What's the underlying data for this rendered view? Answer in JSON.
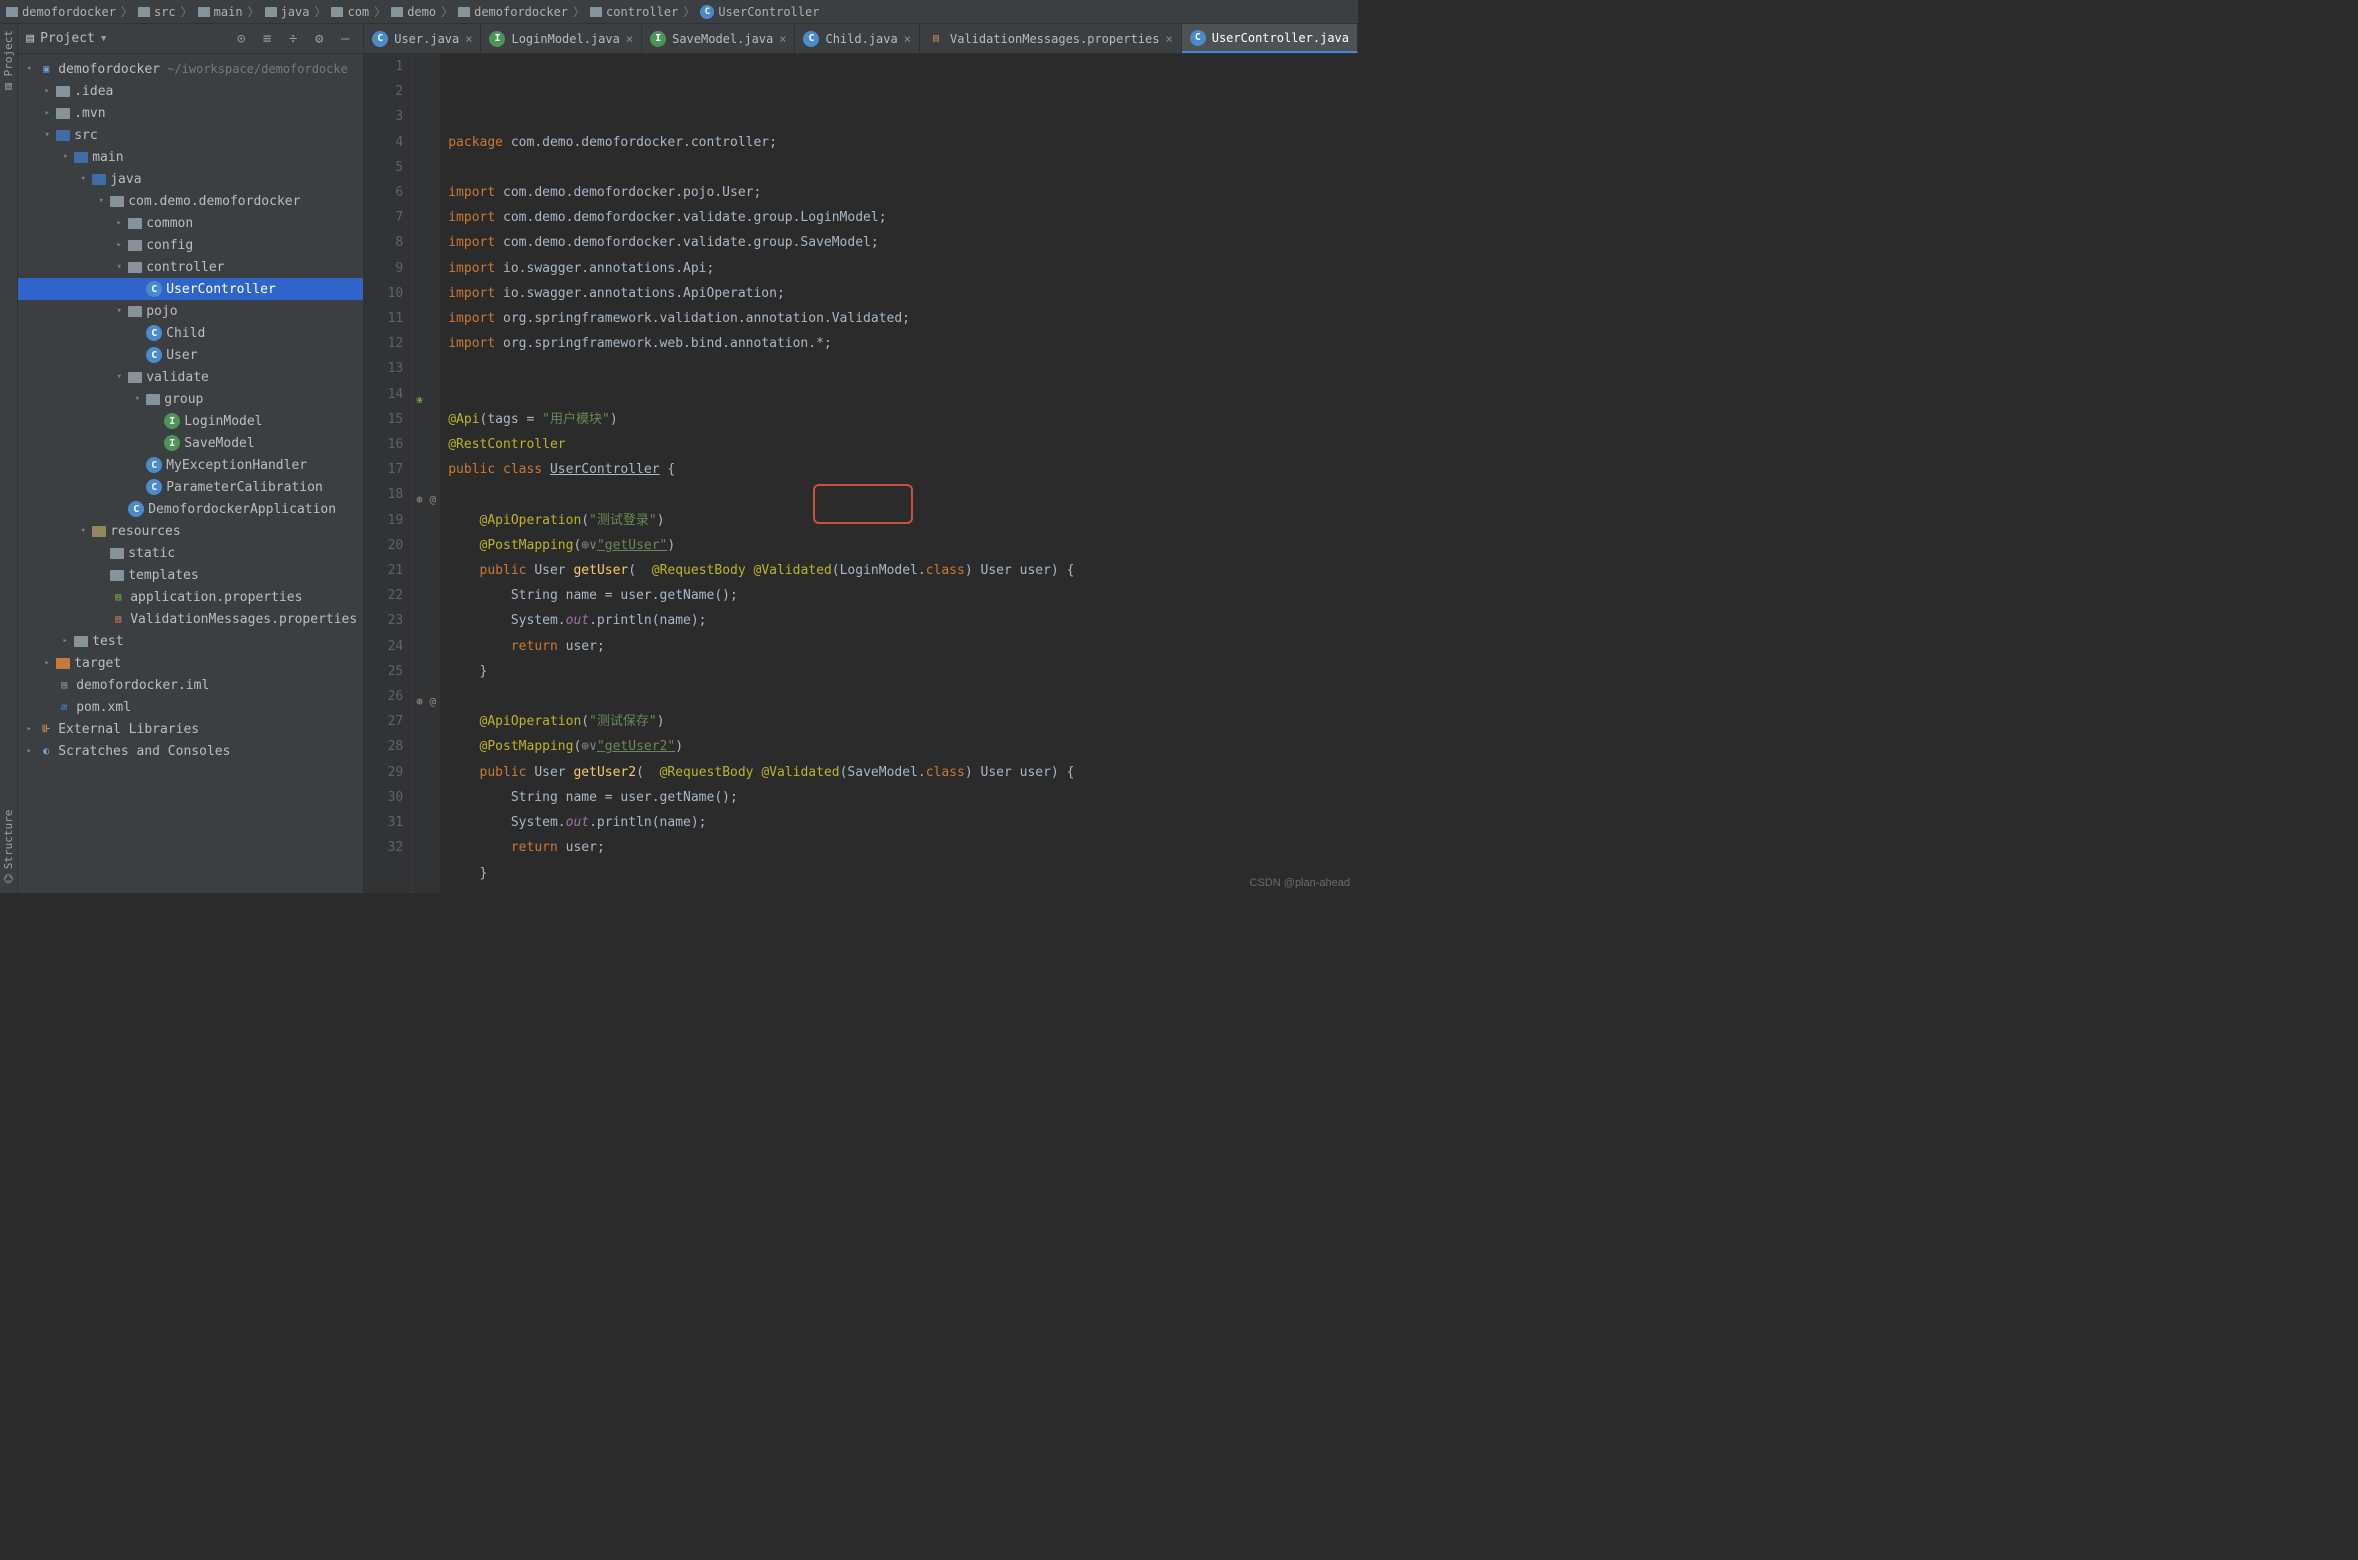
{
  "breadcrumb": [
    "demofordocker",
    "src",
    "main",
    "java",
    "com",
    "demo",
    "demofordocker",
    "controller",
    "UserController"
  ],
  "project": {
    "title": "Project",
    "tree": [
      {
        "depth": 0,
        "arrow": "down",
        "icon": "module",
        "label": "demofordocker",
        "dim": "  ~/iworkspace/demofordocke"
      },
      {
        "depth": 1,
        "arrow": "right",
        "icon": "folder",
        "label": ".idea"
      },
      {
        "depth": 1,
        "arrow": "right",
        "icon": "folder",
        "label": ".mvn"
      },
      {
        "depth": 1,
        "arrow": "down",
        "icon": "folder-src",
        "label": "src"
      },
      {
        "depth": 2,
        "arrow": "down",
        "icon": "folder-src",
        "label": "main"
      },
      {
        "depth": 3,
        "arrow": "down",
        "icon": "folder-src",
        "label": "java"
      },
      {
        "depth": 4,
        "arrow": "down",
        "icon": "pkg",
        "label": "com.demo.demofordocker"
      },
      {
        "depth": 5,
        "arrow": "right",
        "icon": "pkg",
        "label": "common"
      },
      {
        "depth": 5,
        "arrow": "right",
        "icon": "pkg",
        "label": "config"
      },
      {
        "depth": 5,
        "arrow": "down",
        "icon": "pkg",
        "label": "controller"
      },
      {
        "depth": 6,
        "arrow": "none",
        "icon": "class",
        "label": "UserController",
        "selected": true
      },
      {
        "depth": 5,
        "arrow": "down",
        "icon": "pkg",
        "label": "pojo"
      },
      {
        "depth": 6,
        "arrow": "none",
        "icon": "class",
        "label": "Child"
      },
      {
        "depth": 6,
        "arrow": "none",
        "icon": "class",
        "label": "User"
      },
      {
        "depth": 5,
        "arrow": "down",
        "icon": "pkg",
        "label": "validate"
      },
      {
        "depth": 6,
        "arrow": "down",
        "icon": "pkg",
        "label": "group"
      },
      {
        "depth": 7,
        "arrow": "none",
        "icon": "interface",
        "label": "LoginModel"
      },
      {
        "depth": 7,
        "arrow": "none",
        "icon": "interface",
        "label": "SaveModel"
      },
      {
        "depth": 6,
        "arrow": "none",
        "icon": "class",
        "label": "MyExceptionHandler"
      },
      {
        "depth": 6,
        "arrow": "none",
        "icon": "class",
        "label": "ParameterCalibration"
      },
      {
        "depth": 5,
        "arrow": "none",
        "icon": "class-spring",
        "label": "DemofordockerApplication"
      },
      {
        "depth": 3,
        "arrow": "down",
        "icon": "folder-res",
        "label": "resources"
      },
      {
        "depth": 4,
        "arrow": "none",
        "icon": "folder",
        "label": "static"
      },
      {
        "depth": 4,
        "arrow": "none",
        "icon": "folder",
        "label": "templates"
      },
      {
        "depth": 4,
        "arrow": "none",
        "icon": "file-spring",
        "label": "application.properties"
      },
      {
        "depth": 4,
        "arrow": "none",
        "icon": "file-prop",
        "label": "ValidationMessages.properties"
      },
      {
        "depth": 2,
        "arrow": "right",
        "icon": "folder",
        "label": "test"
      },
      {
        "depth": 1,
        "arrow": "right",
        "icon": "folder-target",
        "label": "target"
      },
      {
        "depth": 1,
        "arrow": "none",
        "icon": "file",
        "label": "demofordocker.iml"
      },
      {
        "depth": 1,
        "arrow": "none",
        "icon": "xml",
        "label": "pom.xml"
      },
      {
        "depth": 0,
        "arrow": "right",
        "icon": "lib",
        "label": "External Libraries"
      },
      {
        "depth": 0,
        "arrow": "right",
        "icon": "scratch",
        "label": "Scratches and Consoles"
      }
    ]
  },
  "tabs": [
    {
      "icon": "class",
      "label": "User.java"
    },
    {
      "icon": "interface",
      "label": "LoginModel.java"
    },
    {
      "icon": "interface",
      "label": "SaveModel.java"
    },
    {
      "icon": "class",
      "label": "Child.java"
    },
    {
      "icon": "prop",
      "label": "ValidationMessages.properties"
    },
    {
      "icon": "class",
      "label": "UserController.java",
      "active": true
    }
  ],
  "code": {
    "lines": [
      {
        "n": 1,
        "html": "<span class='kw'>package</span> com.demo.demofordocker.controller;"
      },
      {
        "n": 2,
        "html": ""
      },
      {
        "n": 3,
        "html": "<span class='kw'>import</span> com.demo.demofordocker.pojo.User;"
      },
      {
        "n": 4,
        "html": "<span class='kw'>import</span> com.demo.demofordocker.validate.group.LoginModel;"
      },
      {
        "n": 5,
        "html": "<span class='kw'>import</span> com.demo.demofordocker.validate.group.SaveModel;"
      },
      {
        "n": 6,
        "html": "<span class='kw'>import</span> io.swagger.annotations.Api;"
      },
      {
        "n": 7,
        "html": "<span class='kw'>import</span> io.swagger.annotations.ApiOperation;"
      },
      {
        "n": 8,
        "html": "<span class='kw'>import</span> org.springframework.validation.annotation.Validated;"
      },
      {
        "n": 9,
        "html": "<span class='kw'>import</span> org.springframework.web.bind.annotation.*;"
      },
      {
        "n": 10,
        "html": ""
      },
      {
        "n": 11,
        "html": ""
      },
      {
        "n": 12,
        "html": "<span class='ann'>@Api</span>(tags = <span class='str'>\"用户模块\"</span>)"
      },
      {
        "n": 13,
        "html": "<span class='ann'>@RestController</span>"
      },
      {
        "n": 14,
        "html": "<span class='kw'>public class</span> <span class='cls und'>UserController</span> {",
        "gic": "spring"
      },
      {
        "n": 15,
        "html": ""
      },
      {
        "n": 16,
        "html": "    <span class='ann'>@ApiOperation</span>(<span class='str'>\"测试登录\"</span>)"
      },
      {
        "n": 17,
        "html": "    <span class='ann'>@PostMapping</span>(<span class='cmt'>⊕∨</span><span class='str und'>\"getUser\"</span>)"
      },
      {
        "n": 18,
        "html": "    <span class='kw'>public</span> User <span class='fn'>getUser</span>(  <span class='ann'>@RequestBody</span> <span class='ann'>@Validated</span>(LoginModel.<span class='kw'>class</span>) User user) {",
        "gic": "web"
      },
      {
        "n": 19,
        "html": "        String name = user.getName();"
      },
      {
        "n": 20,
        "html": "        System.<span class='it'>out</span>.println(name);"
      },
      {
        "n": 21,
        "html": "        <span class='kw'>return</span> user;"
      },
      {
        "n": 22,
        "html": "    }"
      },
      {
        "n": 23,
        "html": ""
      },
      {
        "n": 24,
        "html": "    <span class='ann'>@ApiOperation</span>(<span class='str'>\"测试保存\"</span>)"
      },
      {
        "n": 25,
        "html": "    <span class='ann'>@PostMapping</span>(<span class='cmt'>⊕∨</span><span class='str und'>\"getUser2\"</span>)"
      },
      {
        "n": 26,
        "html": "    <span class='kw'>public</span> User <span class='fn'>getUser2</span>(  <span class='ann'>@RequestBody</span> <span class='ann'>@Validated</span>(SaveModel.<span class='kw'>class</span>) User user) {",
        "gic": "web"
      },
      {
        "n": 27,
        "html": "        String name = user.getName();"
      },
      {
        "n": 28,
        "html": "        System.<span class='it'>out</span>.println(name);"
      },
      {
        "n": 29,
        "html": "        <span class='kw'>return</span> user;"
      },
      {
        "n": 30,
        "html": "    }"
      },
      {
        "n": 31,
        "html": ""
      },
      {
        "n": 32,
        "html": "}"
      }
    ]
  },
  "side_labels": {
    "project": "Project",
    "structure": "Structure"
  },
  "watermark": "CSDN @plan-ahead"
}
